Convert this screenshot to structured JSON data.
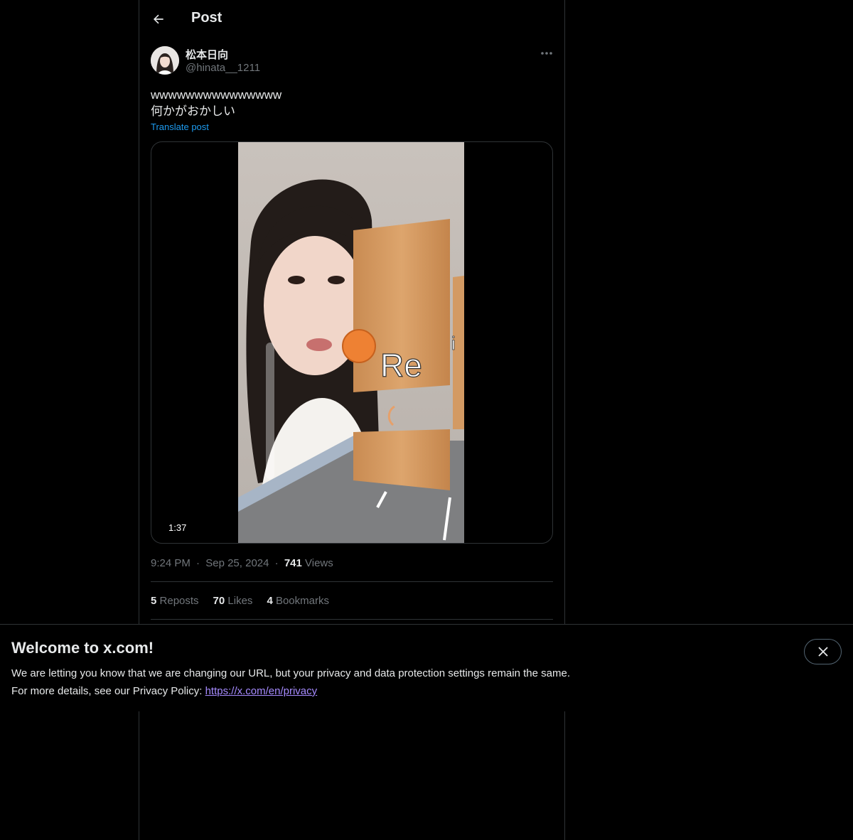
{
  "header": {
    "title": "Post"
  },
  "post": {
    "author_name": "松本日向",
    "author_handle": "@hinata__1211",
    "text": "wwwwwwwwwwwwwww\n何かがおかしい",
    "translate_label": "Translate post",
    "video": {
      "duration": "1:37",
      "overlay_text": "Re",
      "overlay_letter": "i"
    },
    "time": "9:24 PM",
    "date": "Sep 25, 2024",
    "views_count": "741",
    "views_label": "Views",
    "separator": "·",
    "stats": {
      "reposts_count": "5",
      "reposts_label": "Reposts",
      "likes_count": "70",
      "likes_label": "Likes",
      "bookmarks_count": "4",
      "bookmarks_label": "Bookmarks"
    }
  },
  "banner": {
    "title": "Welcome to x.com!",
    "line1": "We are letting you know that we are changing our URL, but your privacy and data protection settings remain the same.",
    "line2_prefix": "For more details, see our Privacy Policy: ",
    "link_text": "https://x.com/en/privacy"
  },
  "colors": {
    "background": "#000000",
    "text_primary": "#e7e9ea",
    "text_secondary": "#71767b",
    "accent": "#1d9bf0",
    "border": "#2f3336",
    "link_visited": "#a68bff"
  },
  "icons": {
    "back": "arrow-left-icon",
    "more": "more-horizontal-icon",
    "close": "close-icon"
  }
}
